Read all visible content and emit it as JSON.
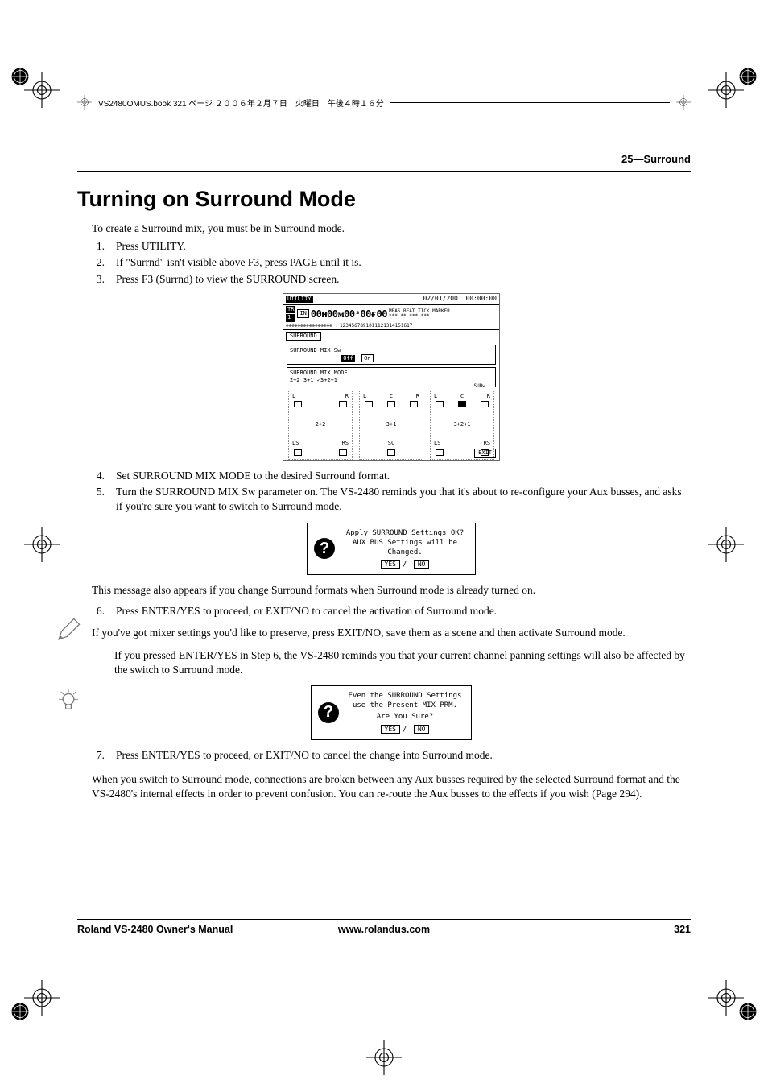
{
  "print_header": "VS2480OMUS.book  321 ページ  ２００６年２月７日　火曜日　午後４時１６分",
  "section_header": "25—Surround",
  "title": "Turning on Surround Mode",
  "intro": "To create a Surround mix, you must be in Surround mode.",
  "steps_a": [
    "Press UTILITY.",
    "If \"Surrnd\" isn't visible above F3, press PAGE until it is.",
    "Press F3 (Surrnd) to view the SURROUND screen."
  ],
  "screenshot1": {
    "title_chip": "UTILITY",
    "tr_chip": "TR",
    "one_chip": "1",
    "in_chip": "IN",
    "timecode": "00ʜ00ᴍ00ˢ00ғ00",
    "date": "02/01/2001 00:00:00",
    "meta": "***-**-*** ***",
    "counter": "1234567891011121314151617",
    "tab": "SURROUND",
    "sw_label": "SURROUND MIX Sw",
    "sw_off": "Off",
    "sw_on": "On",
    "mode_label": "SURROUND MIX MODE",
    "mode_opts": "2+2      3+1    ✓3+2+1",
    "cells": [
      "2+2",
      "3+1",
      "3+2+1"
    ],
    "subw": "SUBw",
    "exit": "EXIT"
  },
  "steps_b": [
    "Set SURROUND MIX MODE to the desired Surround format.",
    "Turn the SURROUND MIX Sw parameter on. The VS-2480 reminds you that it's about to re-configure your Aux busses, and asks if you're sure you want to switch to Surround mode."
  ],
  "dialog1": {
    "line1": "Apply SURROUND Settings OK?",
    "line2": "AUX BUS Settings will be Changed.",
    "yes": "YES",
    "no": "NO"
  },
  "note1": "This message also appears if you change Surround formats when Surround mode is already turned on.",
  "steps_c": [
    "Press ENTER/YES to proceed, or EXIT/NO to cancel the activation of Surround mode."
  ],
  "tip": "If you've got mixer settings you'd like to preserve, press EXIT/NO, save them as a scene and then activate Surround mode.",
  "post_tip": "If you pressed ENTER/YES in Step 6, the VS-2480 reminds you that your current channel panning settings will also be affected by the switch to Surround mode.",
  "dialog2": {
    "line1": "Even the SURROUND Settings",
    "line2": "use the Present MIX PRM.",
    "line3": "Are You Sure?",
    "yes": "YES",
    "no": "NO"
  },
  "steps_d": [
    "Press ENTER/YES to proceed, or EXIT/NO to cancel the change into Surround mode."
  ],
  "closing": "When you switch to Surround mode, connections are broken between any Aux busses required by the selected Surround format and the VS-2480's internal effects in order to prevent confusion. You can re-route the Aux busses to the effects if you wish (Page 294).",
  "footer": {
    "left": "Roland VS-2480 Owner's Manual",
    "center": "www.rolandus.com",
    "right": "321"
  }
}
